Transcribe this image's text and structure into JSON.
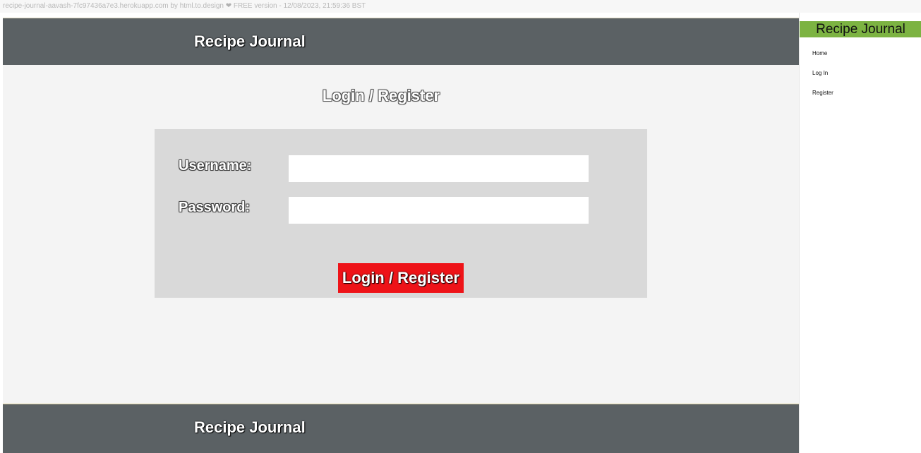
{
  "capture_bar": {
    "text_before": "recipe-journal-aavash-7fc97436a7e3.herokuapp.com by html.to.design",
    "heart": "❤",
    "text_after": "FREE version - 12/08/2023, 21:59:36 BST"
  },
  "header": {
    "title": "Recipe Journal"
  },
  "page": {
    "heading": "Login / Register"
  },
  "form": {
    "username_label": "Username:",
    "username_value": "",
    "password_label": "Password:",
    "password_value": "",
    "submit_label": "Login / Register"
  },
  "footer": {
    "title": "Recipe Journal"
  },
  "sidebar": {
    "title": "Recipe Journal",
    "items": [
      {
        "label": "Home"
      },
      {
        "label": "Log In"
      },
      {
        "label": "Register"
      }
    ]
  },
  "colors": {
    "header_bg": "#5b6164",
    "page_bg": "#f4f4f4",
    "form_bg": "#d9d9d9",
    "button_bg": "#ee1318",
    "sidebar_title_bg": "#7cb342"
  }
}
